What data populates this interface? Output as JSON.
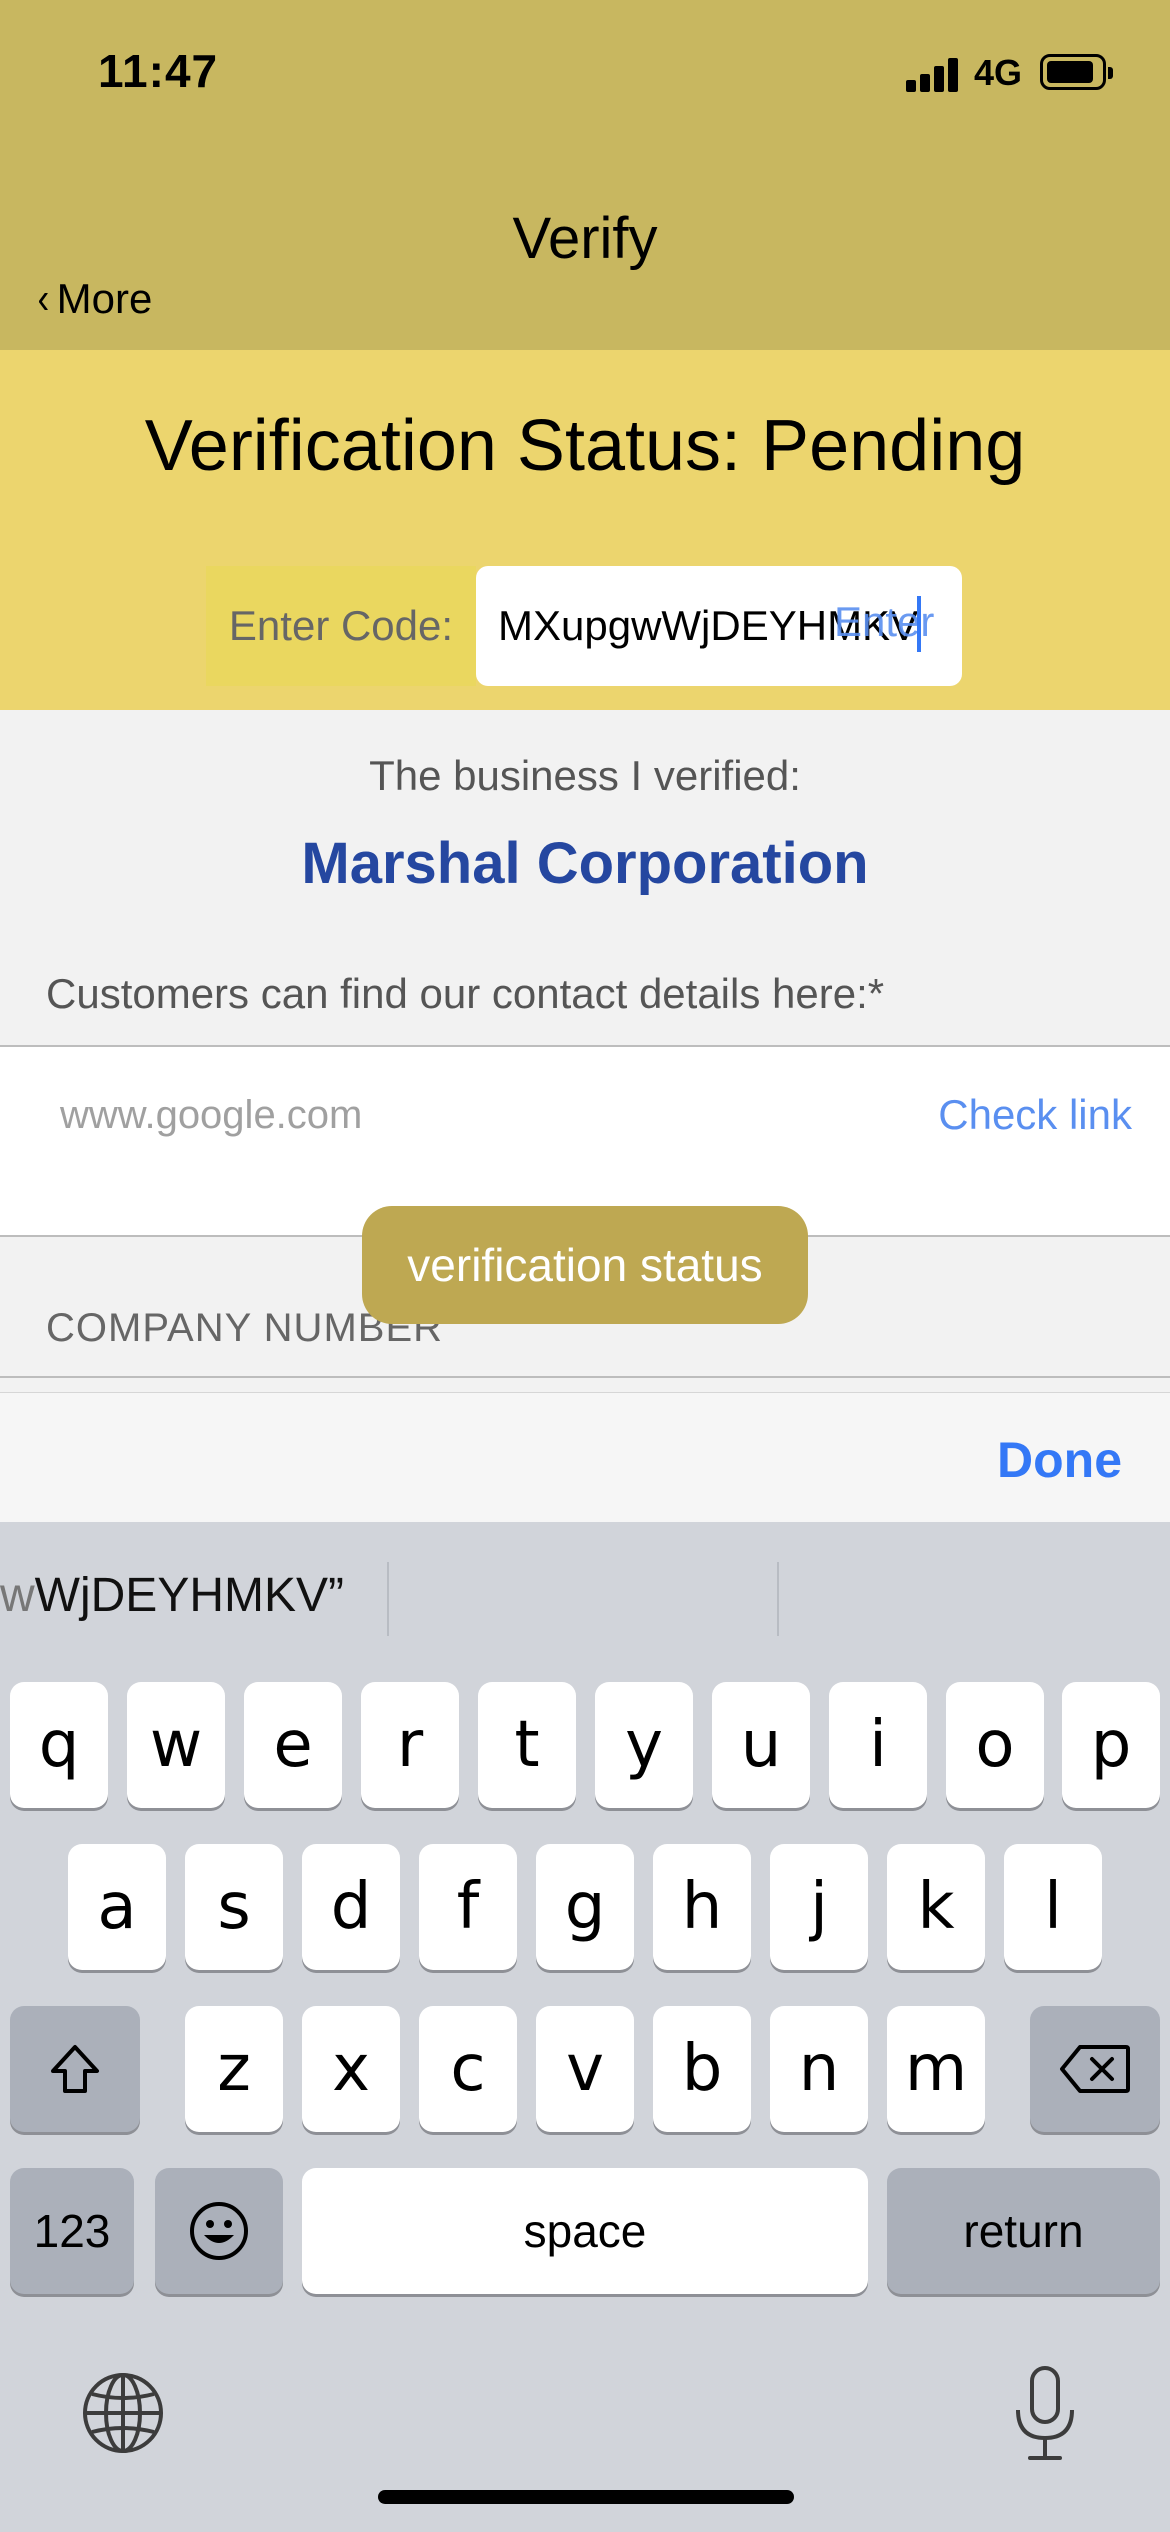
{
  "status_bar": {
    "time": "11:47",
    "network": "4G"
  },
  "nav": {
    "title": "Verify",
    "back_label": "More"
  },
  "verification": {
    "heading": "Verification Status: Pending",
    "code_label": "Enter Code:",
    "code_value": "MXupgwWjDEYHMKV",
    "enter_label": "Enter"
  },
  "business": {
    "label": "The business I verified:",
    "name": "Marshal Corporation",
    "contact_label": "Customers can find our contact details here:*",
    "link_placeholder": "www.google.com",
    "check_link_label": "Check link",
    "company_number_label": "COMPANY NUMBER"
  },
  "toast": "verification status",
  "toolbar": {
    "done_label": "Done"
  },
  "keyboard": {
    "suggestion_prefix": "w",
    "suggestion": "WjDEYHMKV”",
    "row1": [
      "q",
      "w",
      "e",
      "r",
      "t",
      "y",
      "u",
      "i",
      "o",
      "p"
    ],
    "row2": [
      "a",
      "s",
      "d",
      "f",
      "g",
      "h",
      "j",
      "k",
      "l"
    ],
    "row3": [
      "z",
      "x",
      "c",
      "v",
      "b",
      "n",
      "m"
    ],
    "numbers_label": "123",
    "space_label": "space",
    "return_label": "return"
  },
  "colors": {
    "nav_bg": "#c8b760",
    "status_panel_bg": "#ecd56e",
    "business_name": "#2547a0",
    "link_blue": "#5a8ff0",
    "toast_bg": "#bea852"
  },
  "icons": [
    "signal-icon",
    "battery-icon",
    "back-chevron-icon",
    "shift-icon",
    "delete-icon",
    "emoji-icon",
    "globe-icon",
    "microphone-icon"
  ]
}
